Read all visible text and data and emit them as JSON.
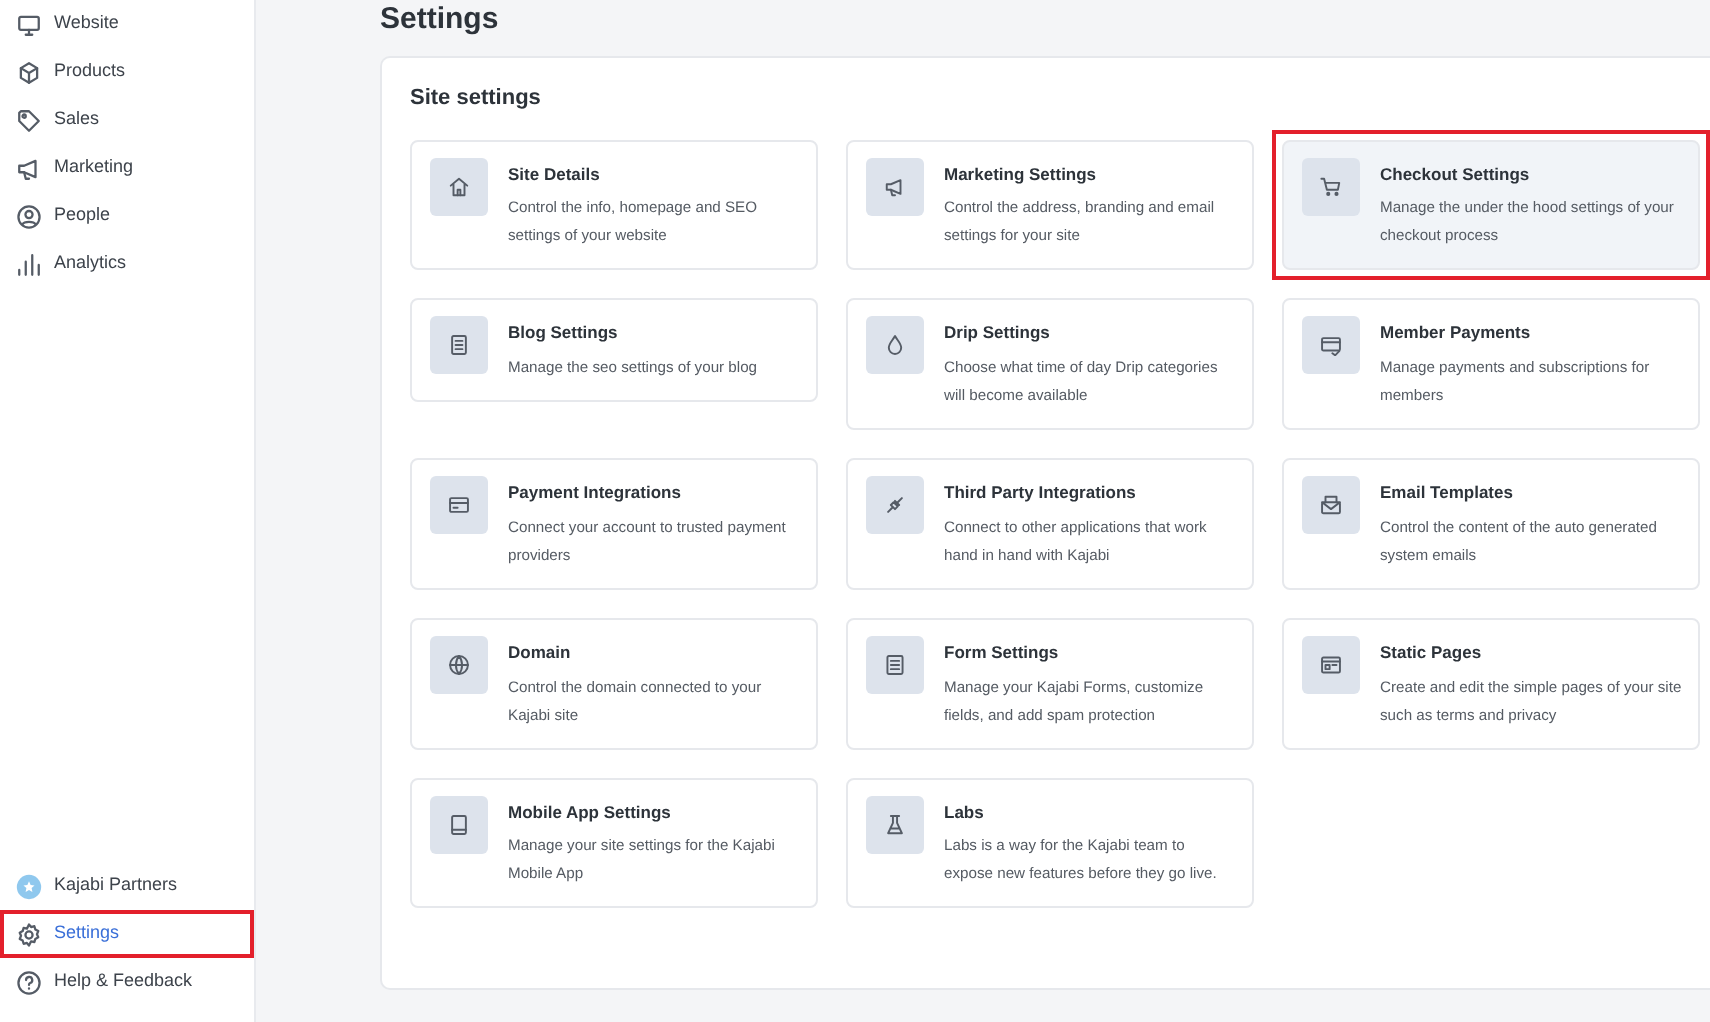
{
  "sidebar": {
    "items": [
      {
        "label": "Website",
        "selected": false,
        "highlighted": false
      },
      {
        "label": "Products",
        "selected": false,
        "highlighted": false
      },
      {
        "label": "Sales",
        "selected": false,
        "highlighted": false
      },
      {
        "label": "Marketing",
        "selected": false,
        "highlighted": false
      },
      {
        "label": "People",
        "selected": false,
        "highlighted": false
      },
      {
        "label": "Analytics",
        "selected": false,
        "highlighted": false
      }
    ],
    "bottom_items": [
      {
        "label": "Kajabi Partners",
        "selected": false,
        "highlighted": false
      },
      {
        "label": "Settings",
        "selected": true,
        "highlighted": true
      },
      {
        "label": "Help & Feedback",
        "selected": false,
        "highlighted": false
      }
    ]
  },
  "page": {
    "title": "Settings"
  },
  "panel": {
    "title": "Site settings",
    "cards": [
      {
        "title": "Site Details",
        "description": "Control the info, homepage and SEO settings of your website",
        "hovered": false,
        "highlighted": false
      },
      {
        "title": "Marketing Settings",
        "description": "Control the address, branding and email settings for your site",
        "hovered": false,
        "highlighted": false
      },
      {
        "title": "Checkout Settings",
        "description": "Manage the under the hood settings of your checkout process",
        "hovered": true,
        "highlighted": true
      },
      {
        "title": "Blog Settings",
        "description": "Manage the seo settings of your blog",
        "hovered": false,
        "highlighted": false
      },
      {
        "title": "Drip Settings",
        "description": "Choose what time of day Drip categories will become available",
        "hovered": false,
        "highlighted": false
      },
      {
        "title": "Member Payments",
        "description": "Manage payments and subscriptions for members",
        "hovered": false,
        "highlighted": false
      },
      {
        "title": "Payment Integrations",
        "description": "Connect your account to trusted payment providers",
        "hovered": false,
        "highlighted": false
      },
      {
        "title": "Third Party Integrations",
        "description": "Connect to other applications that work hand in hand with Kajabi",
        "hovered": false,
        "highlighted": false
      },
      {
        "title": "Email Templates",
        "description": "Control the content of the auto generated system emails",
        "hovered": false,
        "highlighted": false
      },
      {
        "title": "Domain",
        "description": "Control the domain connected to your Kajabi site",
        "hovered": false,
        "highlighted": false
      },
      {
        "title": "Form Settings",
        "description": "Manage your Kajabi Forms, customize fields, and add spam protection",
        "hovered": false,
        "highlighted": false
      },
      {
        "title": "Static Pages",
        "description": "Create and edit the simple pages of your site such as terms and privacy",
        "hovered": false,
        "highlighted": false
      },
      {
        "title": "Mobile App Settings",
        "description": "Manage your site settings for the Kajabi Mobile App",
        "hovered": false,
        "highlighted": false
      },
      {
        "title": "Labs",
        "description": "Labs is a way for the Kajabi team to expose new features before they go live.",
        "hovered": false,
        "highlighted": false
      }
    ]
  }
}
